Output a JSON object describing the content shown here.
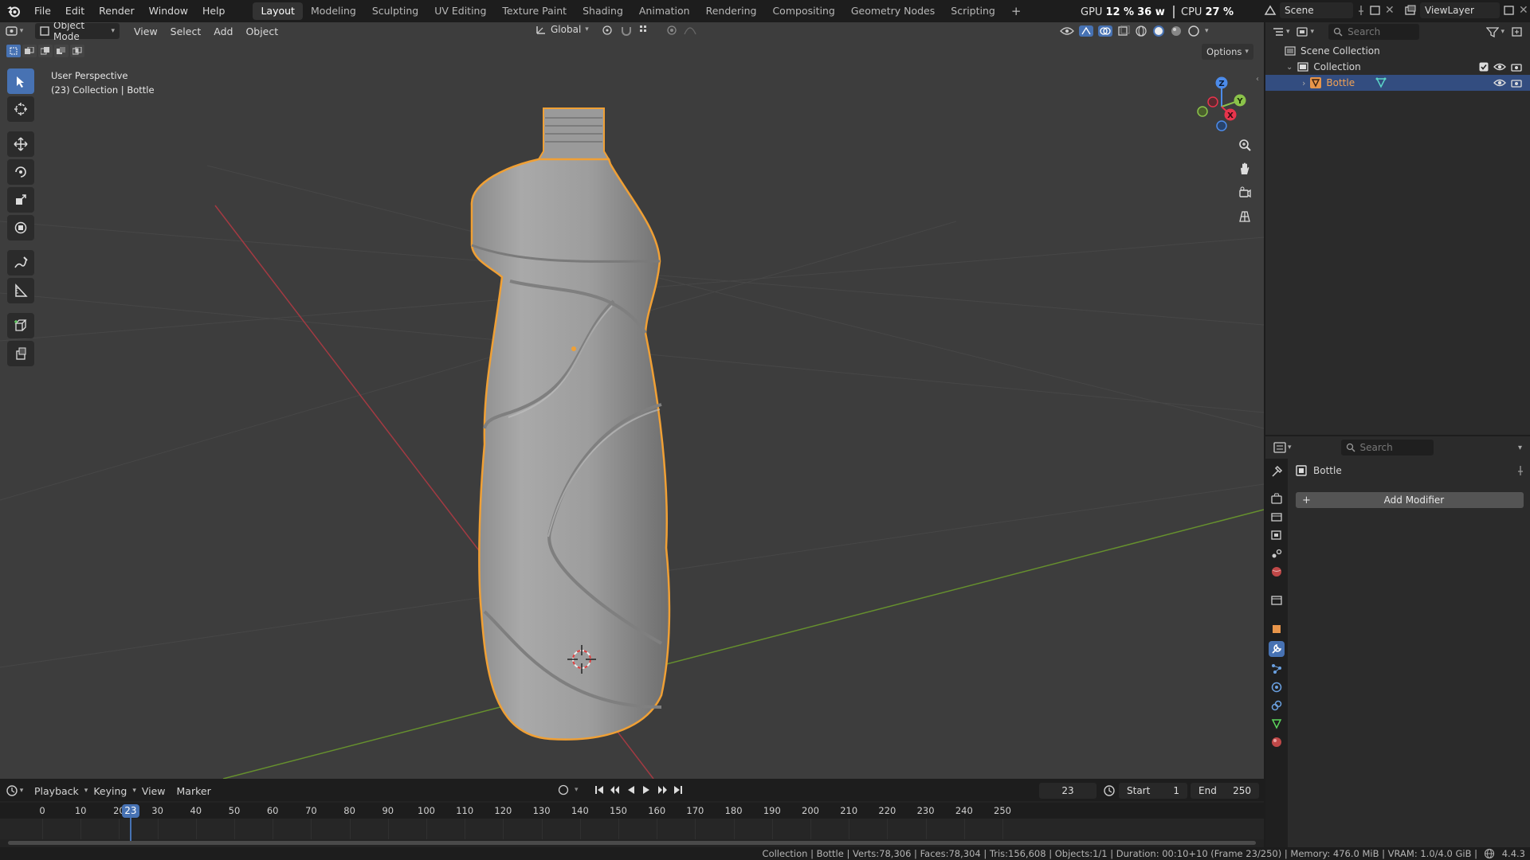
{
  "topbar": {
    "menus": [
      "File",
      "Edit",
      "Render",
      "Window",
      "Help"
    ],
    "workspaces": [
      "Layout",
      "Modeling",
      "Sculpting",
      "UV Editing",
      "Texture Paint",
      "Shading",
      "Animation",
      "Rendering",
      "Compositing",
      "Geometry Nodes",
      "Scripting"
    ],
    "active_workspace": "Layout",
    "add_tab": "+",
    "gpu_label": "GPU",
    "gpu_value": "12 %",
    "gpu_power": "36 w",
    "cpu_label": "CPU",
    "cpu_value": "27 %",
    "scene_name": "Scene",
    "view_layer": "ViewLayer"
  },
  "viewport_header": {
    "mode": "Object Mode",
    "menus": [
      "View",
      "Select",
      "Add",
      "Object"
    ],
    "orientation": "Global",
    "options": "Options"
  },
  "viewport": {
    "perspective": "User Perspective",
    "collection_info": "(23) Collection | Bottle",
    "gizmo_axes": {
      "x": "X",
      "y": "Y",
      "z": "Z"
    },
    "selection_color": "#f0a035",
    "x_axis_color": "#b5343f",
    "y_axis_color": "#6b9a2c"
  },
  "outliner": {
    "search_placeholder": "Search",
    "scene_collection": "Scene Collection",
    "collection": "Collection",
    "object": "Bottle"
  },
  "properties": {
    "search_placeholder": "Search",
    "object_name": "Bottle",
    "add_modifier": "Add Modifier"
  },
  "timeline": {
    "menus": [
      "Playback",
      "Keying",
      "View",
      "Marker"
    ],
    "current_frame": "23",
    "start_label": "Start",
    "start_value": "1",
    "end_label": "End",
    "end_value": "250",
    "ticks": [
      "0",
      "10",
      "20",
      "30",
      "40",
      "50",
      "60",
      "70",
      "80",
      "90",
      "100",
      "110",
      "120",
      "130",
      "140",
      "150",
      "160",
      "170",
      "180",
      "190",
      "200",
      "210",
      "220",
      "230",
      "240",
      "250"
    ],
    "accent_color": "#4772b3"
  },
  "statusbar": {
    "text": "Collection | Bottle | Verts:78,306 | Faces:78,304 | Tris:156,608 | Objects:1/1 | Duration: 00:10+10 (Frame 23/250) | Memory: 476.0 MiB | VRAM: 1.0/4.0 GiB |",
    "version": "4.4.3"
  }
}
